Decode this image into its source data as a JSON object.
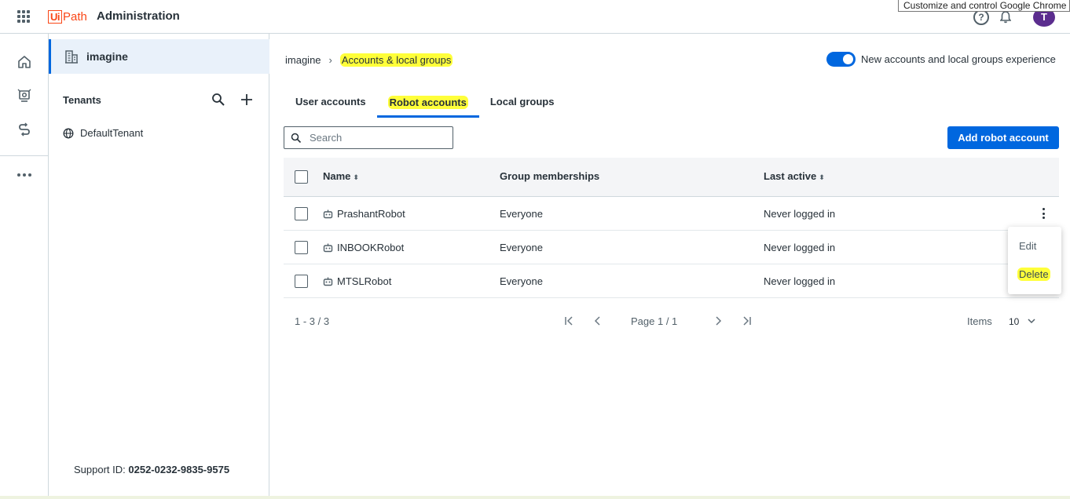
{
  "header": {
    "logo_ui": "Ui",
    "logo_path": "Path",
    "app_title": "Administration",
    "tooltip": "Customize and control Google Chrome",
    "help_glyph": "?",
    "avatar_initial": "T"
  },
  "rail": {
    "icons": [
      "home-icon",
      "monitor-icon",
      "link-icon",
      "more-icon"
    ]
  },
  "panel": {
    "org_name": "imagine",
    "tenants_heading": "Tenants",
    "tenants": [
      "DefaultTenant"
    ],
    "support_label": "Support ID:",
    "support_id": "0252-0232-9835-9575"
  },
  "breadcrumb": {
    "root": "imagine",
    "separator": "›",
    "current": "Accounts & local groups"
  },
  "toggle": {
    "label": "New accounts and local groups experience",
    "on": true
  },
  "tabs": [
    {
      "label": "User accounts",
      "active": false
    },
    {
      "label": "Robot accounts",
      "active": true
    },
    {
      "label": "Local groups",
      "active": false
    }
  ],
  "search": {
    "placeholder": "Search"
  },
  "add_button": "Add robot account",
  "table": {
    "columns": {
      "name": "Name",
      "groups": "Group memberships",
      "last_active": "Last active"
    },
    "rows": [
      {
        "name": "PrashantRobot",
        "groups": "Everyone",
        "last_active": "Never logged in"
      },
      {
        "name": "INBOOKRobot",
        "groups": "Everyone",
        "last_active": "Never logged in"
      },
      {
        "name": "MTSLRobot",
        "groups": "Everyone",
        "last_active": "Never logged in"
      }
    ]
  },
  "pagination": {
    "range": "1 - 3 / 3",
    "page": "Page 1 / 1",
    "items_label": "Items",
    "items_value": "10"
  },
  "context_menu": {
    "edit": "Edit",
    "delete": "Delete"
  },
  "colors": {
    "accent": "#0067df",
    "brand": "#fa4616",
    "highlight": "#ffff3a"
  }
}
